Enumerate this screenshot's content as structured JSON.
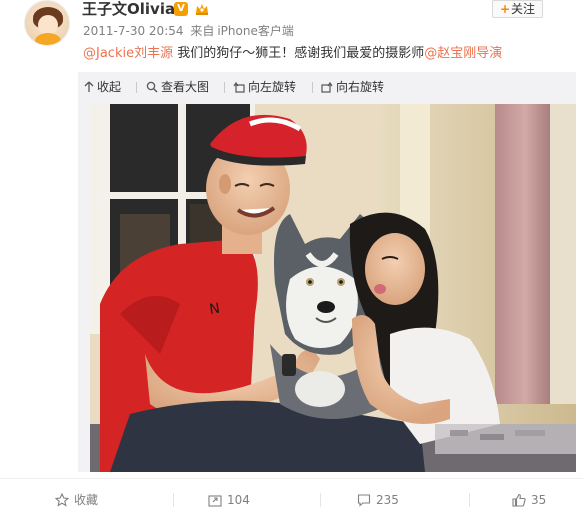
{
  "user": {
    "name": "王子文Olivia",
    "verified_badge": "V",
    "member_icon": "crown-icon"
  },
  "post": {
    "date": "2011-7-30 20:54",
    "source_prefix": "来自",
    "source": "iPhone客户端",
    "text": {
      "mention1": "@Jackie刘丰源",
      "middle": " 我们的狗仔～狮王！感谢我们最爱的摄影师",
      "mention2": "@赵宝刚导演"
    }
  },
  "follow_button": {
    "label": "关注"
  },
  "media_toolbar": {
    "collapse": "收起",
    "view_large": "查看大图",
    "rotate_left": "向左旋转",
    "rotate_right": "向右旋转"
  },
  "footer": {
    "favorite": "收藏",
    "repost_count": "104",
    "comment_count": "235",
    "like_count": "35"
  },
  "colors": {
    "mention": "#eb7350",
    "follow_accent": "#ff8200",
    "badge": "#f5a000",
    "meta_gray": "#808080"
  }
}
